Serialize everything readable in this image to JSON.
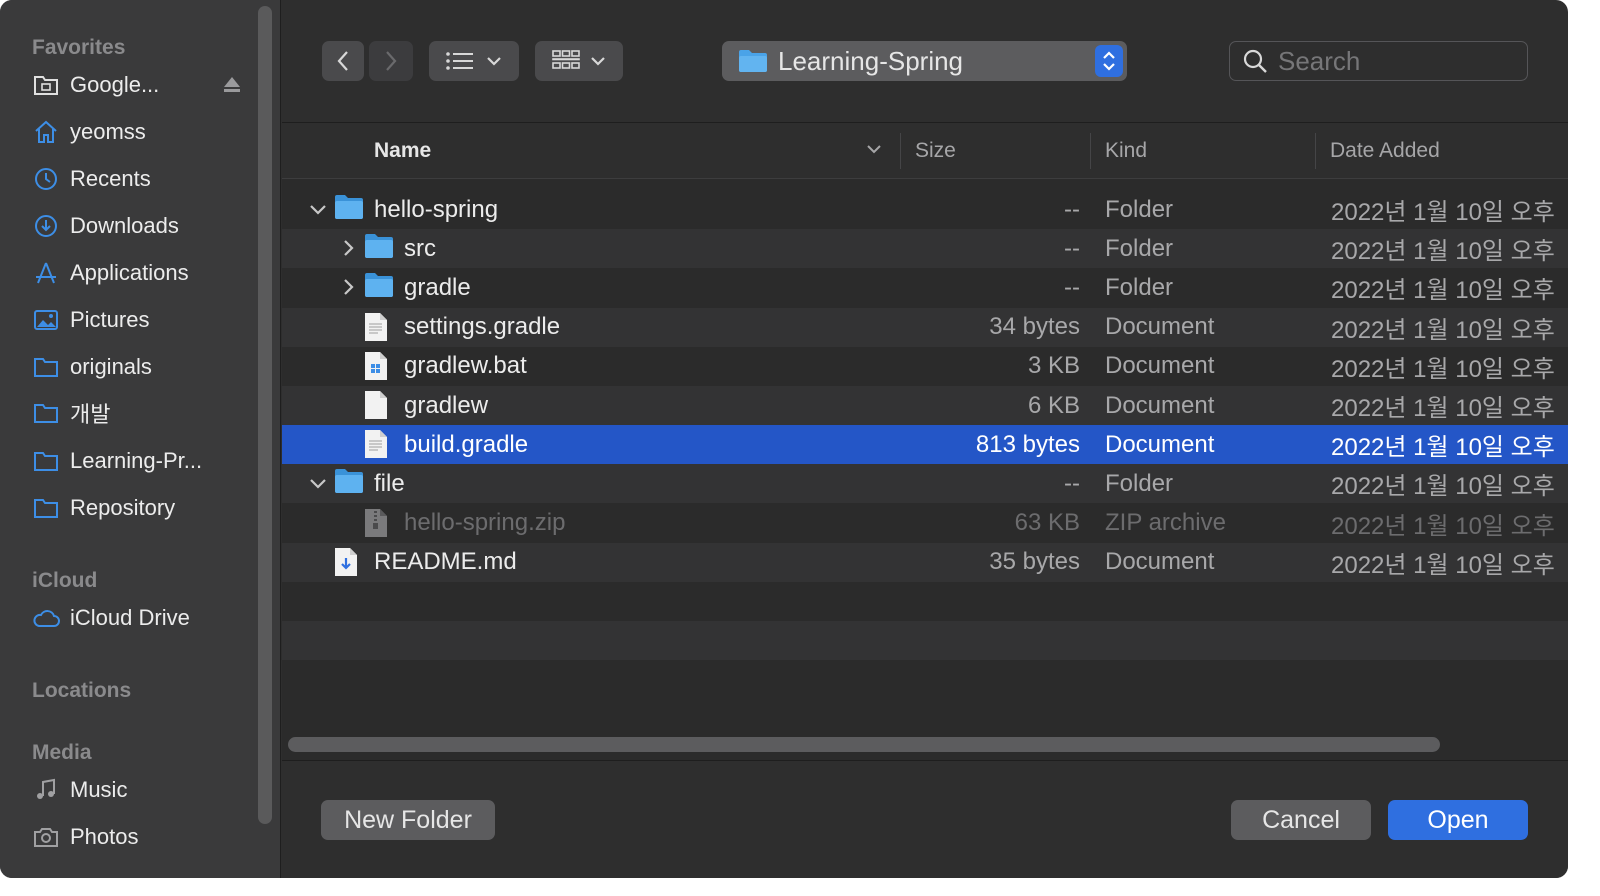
{
  "sidebar": {
    "sections": {
      "favorites": "Favorites",
      "icloud": "iCloud",
      "locations": "Locations",
      "media": "Media"
    },
    "favorites": [
      {
        "label": "Google...",
        "icon": "drive-folder-icon"
      },
      {
        "label": "yeomss",
        "icon": "home-icon"
      },
      {
        "label": "Recents",
        "icon": "clock-icon"
      },
      {
        "label": "Downloads",
        "icon": "download-icon"
      },
      {
        "label": "Applications",
        "icon": "applications-icon"
      },
      {
        "label": "Pictures",
        "icon": "pictures-icon"
      },
      {
        "label": "originals",
        "icon": "folder-icon"
      },
      {
        "label": "개발",
        "icon": "folder-icon"
      },
      {
        "label": "Learning-Pr...",
        "icon": "folder-icon"
      },
      {
        "label": "Repository",
        "icon": "folder-icon"
      }
    ],
    "icloud": [
      {
        "label": "iCloud Drive",
        "icon": "cloud-icon"
      }
    ],
    "media": [
      {
        "label": "Music",
        "icon": "music-note-icon"
      },
      {
        "label": "Photos",
        "icon": "camera-icon"
      }
    ]
  },
  "toolbar": {
    "location": "Learning-Spring",
    "search_placeholder": "Search"
  },
  "columns": {
    "name": "Name",
    "size": "Size",
    "kind": "Kind",
    "date": "Date Added"
  },
  "files": [
    {
      "name": "hello-spring",
      "size": "--",
      "kind": "Folder",
      "date": "2022년 1월 10일 오후",
      "level": 0,
      "disclosure": "open",
      "icon": "folder"
    },
    {
      "name": "src",
      "size": "--",
      "kind": "Folder",
      "date": "2022년 1월 10일 오후",
      "level": 1,
      "disclosure": "closed",
      "icon": "folder"
    },
    {
      "name": "gradle",
      "size": "--",
      "kind": "Folder",
      "date": "2022년 1월 10일 오후",
      "level": 1,
      "disclosure": "closed",
      "icon": "folder"
    },
    {
      "name": "settings.gradle",
      "size": "34 bytes",
      "kind": "Document",
      "date": "2022년 1월 10일 오후",
      "level": 1,
      "disclosure": "none",
      "icon": "doc"
    },
    {
      "name": "gradlew.bat",
      "size": "3 KB",
      "kind": "Document",
      "date": "2022년 1월 10일 오후",
      "level": 1,
      "disclosure": "none",
      "icon": "doc-win"
    },
    {
      "name": "gradlew",
      "size": "6 KB",
      "kind": "Document",
      "date": "2022년 1월 10일 오후",
      "level": 1,
      "disclosure": "none",
      "icon": "doc-blank"
    },
    {
      "name": "build.gradle",
      "size": "813 bytes",
      "kind": "Document",
      "date": "2022년 1월 10일 오후",
      "level": 1,
      "disclosure": "none",
      "icon": "doc",
      "selected": true
    },
    {
      "name": "file",
      "size": "--",
      "kind": "Folder",
      "date": "2022년 1월 10일 오후",
      "level": 0,
      "disclosure": "open",
      "icon": "folder"
    },
    {
      "name": "hello-spring.zip",
      "size": "63 KB",
      "kind": "ZIP archive",
      "date": "2022년 1월 10일 오후",
      "level": 1,
      "disclosure": "none",
      "icon": "zip",
      "dim": true
    },
    {
      "name": "README.md",
      "size": "35 bytes",
      "kind": "Document",
      "date": "2022년 1월 10일 오후",
      "level": 0,
      "disclosure": "none",
      "icon": "doc-md"
    }
  ],
  "buttons": {
    "new_folder": "New Folder",
    "cancel": "Cancel",
    "open": "Open"
  },
  "colors": {
    "accent": "#2f6fe0",
    "selection": "#2456c7",
    "folder": "#4aa3e8",
    "sidebar_icon": "#3d8ee6"
  }
}
